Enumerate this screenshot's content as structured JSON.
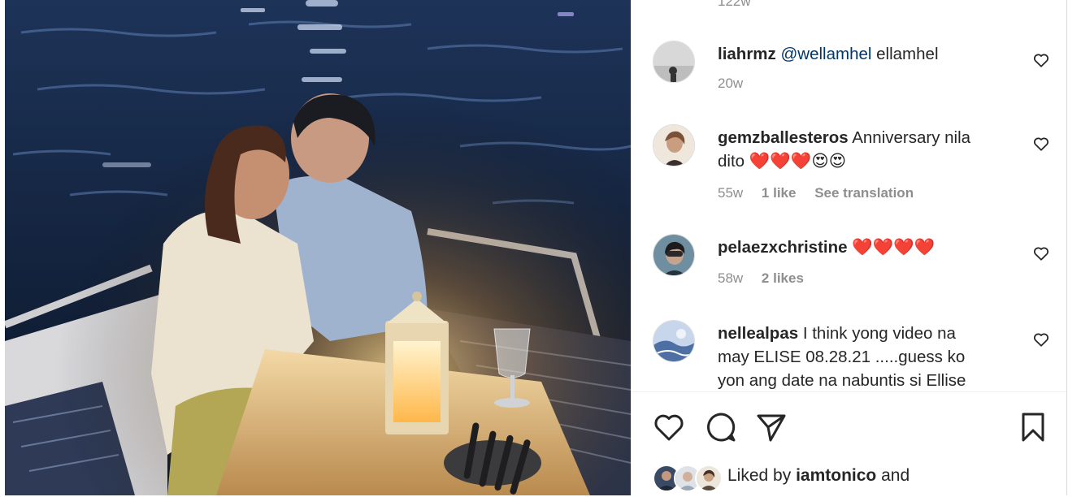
{
  "previous_comment": {
    "timestamp": "122w"
  },
  "comments": [
    {
      "username": "liahrmz",
      "mention": "@wellamhel",
      "text": " ellamhel",
      "time": "20w",
      "likes": "",
      "translate": ""
    },
    {
      "username": "gemzballesteros",
      "text_line1": " Anniversary nila",
      "text_line2": "dito ❤️❤️❤️😍😍",
      "time": "55w",
      "likes": "1 like",
      "translate": "See translation"
    },
    {
      "username": "pelaezxchristine",
      "text": " ❤️❤️❤️❤️",
      "time": "58w",
      "likes": "2 likes",
      "translate": ""
    },
    {
      "username": "nellealpas",
      "text_line1": " I think yong video na",
      "text_line2": "may ELISE 08.28.21 .....guess ko",
      "text_line3": "yon ang date na nabuntis si Ellise"
    }
  ],
  "icons": {
    "comment_like": "heart-outline-icon",
    "like": "heart-outline-icon",
    "comment": "speech-bubble-icon",
    "share": "paper-plane-icon",
    "save": "bookmark-icon"
  },
  "liked_by": {
    "prefix": "Liked by ",
    "user": "iamtonico",
    "suffix": " and"
  },
  "colors": {
    "text": "#262626",
    "secondary": "#8e8e8e",
    "mention": "#00376b",
    "divider": "#efefef"
  }
}
